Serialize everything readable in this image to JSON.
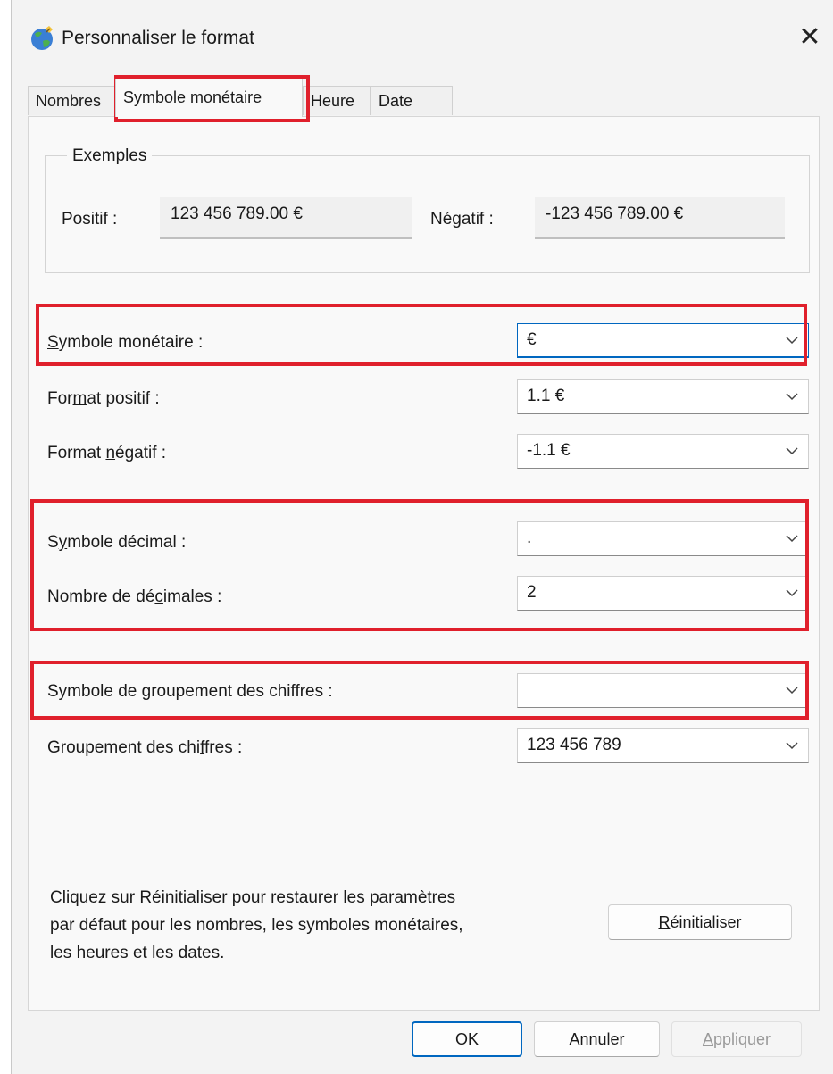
{
  "window": {
    "title": "Personnaliser le format",
    "close_glyph": "✕",
    "icon": "globe-icon"
  },
  "tabs": [
    {
      "label": "Nombres"
    },
    {
      "label": "Symbole monétaire",
      "active": true
    },
    {
      "label": "Heure"
    },
    {
      "label": "Date"
    }
  ],
  "examples": {
    "legend": "Exemples",
    "positive_label": "Positif :",
    "positive_value": "123 456 789.00 €",
    "negative_label": "Négatif :",
    "negative_value": "-123 456 789.00 €"
  },
  "fields": {
    "currency_symbol": {
      "label_pre": "",
      "label_u": "S",
      "label_post": "ymbole monétaire :",
      "value": "€"
    },
    "positive_format": {
      "label_pre": "For",
      "label_u": "m",
      "label_post": "at positif :",
      "value": "1.1 €"
    },
    "negative_format": {
      "label_pre": "Format ",
      "label_u": "n",
      "label_post": "égatif :",
      "value": "-1.1 €"
    },
    "decimal_symbol": {
      "label_pre": "S",
      "label_u": "y",
      "label_post": "mbole décimal :",
      "value": "."
    },
    "decimal_count": {
      "label_pre": "Nombre de dé",
      "label_u": "c",
      "label_post": "imales :",
      "value": "2"
    },
    "grouping_symbol": {
      "label_pre": "Symbole de ",
      "label_u": "g",
      "label_post": "roupement des chiffres :",
      "value": ""
    },
    "digit_grouping": {
      "label_pre": "Groupement des chi",
      "label_u": "f",
      "label_post": "fres :",
      "value": "123 456 789"
    }
  },
  "reset": {
    "line1": "Cliquez sur Réinitialiser pour restaurer les paramètres",
    "line2": "par défaut pour les nombres, les symboles monétaires,",
    "line3": "les heures et les dates.",
    "button_u": "R",
    "button_rest": "éinitialiser"
  },
  "footer": {
    "ok_label": "OK",
    "cancel_label": "Annuler",
    "apply_u": "A",
    "apply_rest": "ppliquer"
  },
  "colors": {
    "highlight": "#e0202c",
    "focus": "#0067c0"
  }
}
